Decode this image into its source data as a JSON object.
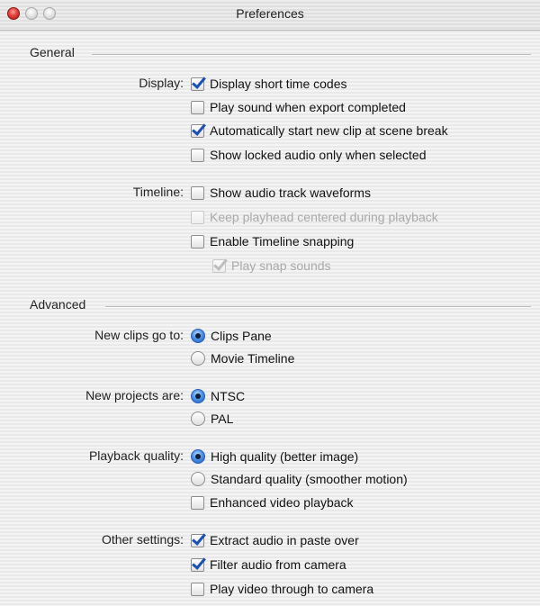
{
  "window": {
    "title": "Preferences",
    "controls": [
      "close",
      "minimize",
      "zoom"
    ]
  },
  "general": {
    "heading": "General",
    "display": {
      "label": "Display:",
      "options": [
        {
          "label": "Display short time codes",
          "checked": true,
          "enabled": true
        },
        {
          "label": "Play sound when export completed",
          "checked": false,
          "enabled": true
        },
        {
          "label": "Automatically start new clip at scene break",
          "checked": true,
          "enabled": true
        },
        {
          "label": "Show locked audio only when selected",
          "checked": false,
          "enabled": true
        }
      ]
    },
    "timeline": {
      "label": "Timeline:",
      "options": [
        {
          "label": "Show audio track waveforms",
          "checked": false,
          "enabled": true
        },
        {
          "label": "Keep playhead centered during playback",
          "checked": false,
          "enabled": false
        },
        {
          "label": "Enable Timeline snapping",
          "checked": false,
          "enabled": true
        },
        {
          "label": "Play snap sounds",
          "checked": true,
          "enabled": false
        }
      ]
    }
  },
  "advanced": {
    "heading": "Advanced",
    "new_clips": {
      "label": "New clips go to:",
      "options": [
        {
          "label": "Clips Pane",
          "selected": true
        },
        {
          "label": "Movie Timeline",
          "selected": false
        }
      ]
    },
    "new_projects": {
      "label": "New projects are:",
      "options": [
        {
          "label": "NTSC",
          "selected": true
        },
        {
          "label": "PAL",
          "selected": false
        }
      ]
    },
    "playback_quality": {
      "label": "Playback quality:",
      "options": [
        {
          "label": "High quality (better image)",
          "selected": true
        },
        {
          "label": "Standard quality (smoother motion)",
          "selected": false
        }
      ],
      "enhanced": {
        "label": "Enhanced video playback",
        "checked": false
      }
    },
    "other_settings": {
      "label": "Other settings:",
      "options": [
        {
          "label": "Extract audio in paste over",
          "checked": true
        },
        {
          "label": "Filter audio from camera",
          "checked": true
        },
        {
          "label": "Play video through to camera",
          "checked": false
        }
      ]
    }
  },
  "colors": {
    "accent": "#1c4fb3",
    "disabled_text": "#a9a9a9",
    "close_button": "#e0403a"
  }
}
